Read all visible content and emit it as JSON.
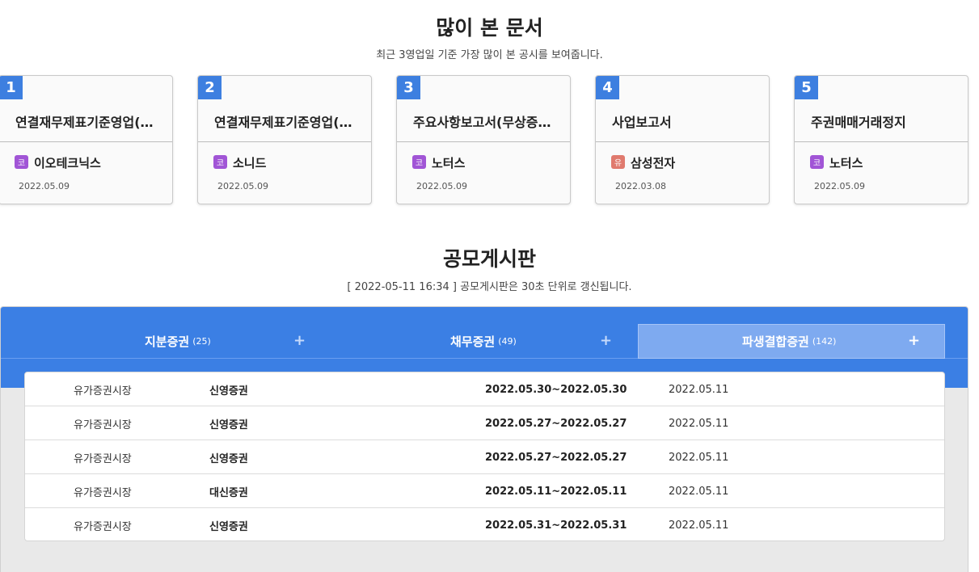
{
  "most_viewed": {
    "title": "많이 본 문서",
    "subtitle": "최근 3영업일 기준 가장 많이 본 공시를 보여줍니다.",
    "cards": [
      {
        "rank": "1",
        "title": "연결재무제표기준영업(…",
        "badge": "코",
        "market": "kosdaq",
        "company": "이오테크닉스",
        "date": "2022.05.09"
      },
      {
        "rank": "2",
        "title": "연결재무제표기준영업(…",
        "badge": "코",
        "market": "kosdaq",
        "company": "소니드",
        "date": "2022.05.09"
      },
      {
        "rank": "3",
        "title": "주요사항보고서(무상증…",
        "badge": "코",
        "market": "kosdaq",
        "company": "노터스",
        "date": "2022.05.09"
      },
      {
        "rank": "4",
        "title": "사업보고서",
        "badge": "유",
        "market": "kospi",
        "company": "삼성전자",
        "date": "2022.03.08"
      },
      {
        "rank": "5",
        "title": "주권매매거래정지",
        "badge": "코",
        "market": "kosdaq",
        "company": "노터스",
        "date": "2022.05.09"
      }
    ]
  },
  "offering_board": {
    "title": "공모게시판",
    "subtitle": "[ 2022-05-11 16:34 ] 공모게시판은 30초 단위로 갱신됩니다.",
    "tabs": [
      {
        "label": "지분증권",
        "count": "(25)",
        "plus": "+",
        "active": false
      },
      {
        "label": "채무증권",
        "count": "(49)",
        "plus": "+",
        "active": false
      },
      {
        "label": "파생결합증권",
        "count": "(142)",
        "plus": "+",
        "active": true
      }
    ],
    "rows": [
      {
        "market": "유가증권시장",
        "firm": "신영증권",
        "period": "2022.05.30~2022.05.30",
        "date": "2022.05.11"
      },
      {
        "market": "유가증권시장",
        "firm": "신영증권",
        "period": "2022.05.27~2022.05.27",
        "date": "2022.05.11"
      },
      {
        "market": "유가증권시장",
        "firm": "신영증권",
        "period": "2022.05.27~2022.05.27",
        "date": "2022.05.11"
      },
      {
        "market": "유가증권시장",
        "firm": "대신증권",
        "period": "2022.05.11~2022.05.11",
        "date": "2022.05.11"
      },
      {
        "market": "유가증권시장",
        "firm": "신영증권",
        "period": "2022.05.31~2022.05.31",
        "date": "2022.05.11"
      }
    ]
  },
  "colors": {
    "accent": "#3b7fe4",
    "kosdaq_badge": "#a155d6",
    "kospi_badge": "#e07a6e"
  }
}
